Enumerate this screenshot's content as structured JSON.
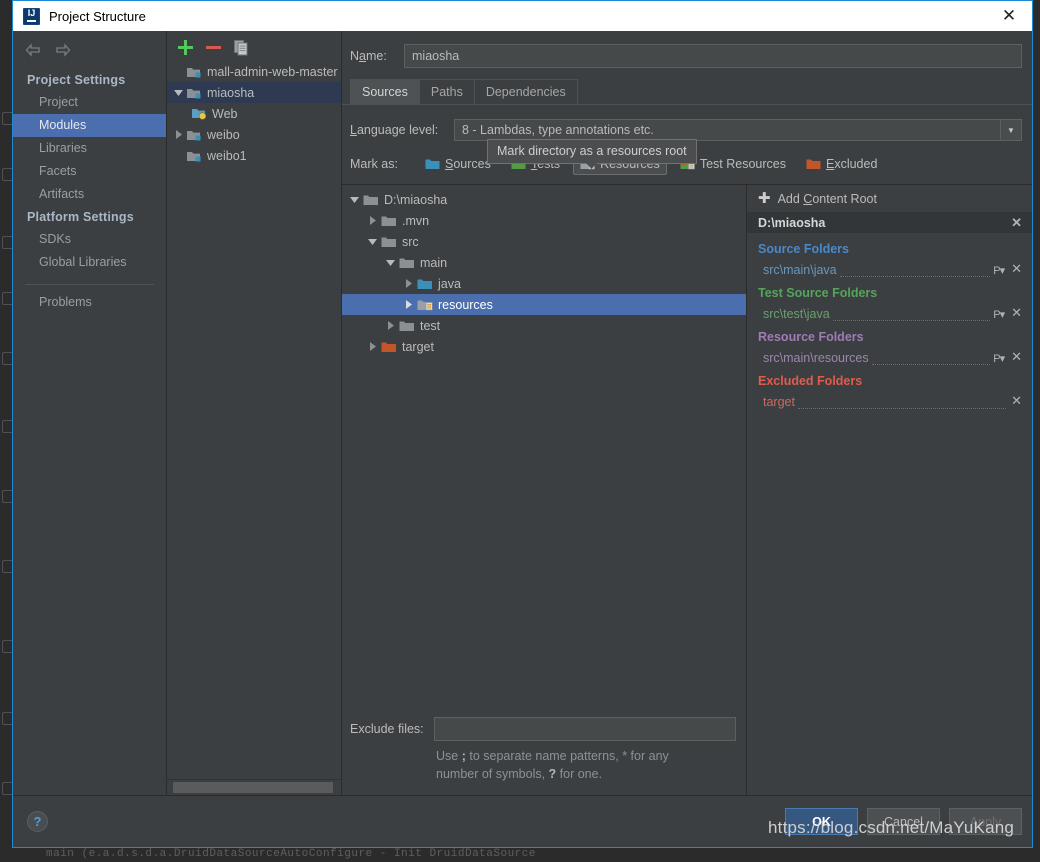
{
  "window": {
    "title": "Project Structure",
    "icon": "intellij-idea-icon",
    "close_label": "✕"
  },
  "left_nav": {
    "back_icon": "arrow-left-icon",
    "forward_icon": "arrow-right-icon",
    "groups": [
      {
        "label": "Project Settings",
        "items": [
          {
            "label": "Project",
            "selected": false
          },
          {
            "label": "Modules",
            "selected": true
          },
          {
            "label": "Libraries",
            "selected": false
          },
          {
            "label": "Facets",
            "selected": false
          },
          {
            "label": "Artifacts",
            "selected": false
          }
        ]
      },
      {
        "label": "Platform Settings",
        "items": [
          {
            "label": "SDKs",
            "selected": false
          },
          {
            "label": "Global Libraries",
            "selected": false
          }
        ]
      }
    ],
    "problems_label": "Problems"
  },
  "modules_panel": {
    "toolbar": {
      "add_icon": "plus-icon",
      "remove_icon": "minus-icon",
      "copy_icon": "copy-icon"
    },
    "items": [
      {
        "label": "mall-admin-web-master",
        "indent": 1,
        "twisty": "none",
        "icon": "module-icon",
        "selected": false
      },
      {
        "label": "miaosha",
        "indent": 1,
        "twisty": "expanded",
        "icon": "module-icon",
        "selected": true
      },
      {
        "label": "Web",
        "indent": 2,
        "twisty": "none",
        "icon": "web-facet-icon",
        "selected": false
      },
      {
        "label": "weibo",
        "indent": 1,
        "twisty": "collapsed",
        "icon": "module-icon",
        "selected": false
      },
      {
        "label": "weibo1",
        "indent": 1,
        "twisty": "none",
        "icon": "module-icon",
        "selected": false
      }
    ]
  },
  "module_editor": {
    "name_label": "Name:",
    "name_value": "miaosha",
    "tabs": [
      {
        "label": "Sources",
        "active": true
      },
      {
        "label": "Paths",
        "active": false
      },
      {
        "label": "Dependencies",
        "active": false
      }
    ],
    "language_level": {
      "label": "Language level:",
      "value": "8 - Lambdas, type annotations etc.",
      "arrow_icon": "chevron-down-icon"
    },
    "mark_as": {
      "label": "Mark as:",
      "buttons": [
        {
          "label": "Sources",
          "icon": "folder-sources-icon",
          "color": "#3b90ba",
          "pressed": false
        },
        {
          "label": "Tests",
          "icon": "folder-tests-icon",
          "color": "#559a47",
          "pressed": false
        },
        {
          "label": "Resources",
          "icon": "folder-resources-icon",
          "color": "#9aa0a6",
          "pressed": true
        },
        {
          "label": "Test Resources",
          "icon": "folder-test-resources-icon",
          "color": "#559a47",
          "pressed": false
        },
        {
          "label": "Excluded",
          "icon": "folder-excluded-icon",
          "color": "#c2562a",
          "pressed": false
        }
      ]
    },
    "tooltip": "Mark directory as a resources root"
  },
  "file_tree": [
    {
      "label": "D:\\miaosha",
      "indent": 0,
      "twisty": "expanded",
      "icon": "folder-grey-icon",
      "selected": false
    },
    {
      "label": ".mvn",
      "indent": 1,
      "twisty": "collapsed",
      "icon": "folder-grey-icon",
      "selected": false
    },
    {
      "label": "src",
      "indent": 1,
      "twisty": "expanded",
      "icon": "folder-grey-icon",
      "selected": false
    },
    {
      "label": "main",
      "indent": 2,
      "twisty": "expanded",
      "icon": "folder-grey-icon",
      "selected": false
    },
    {
      "label": "java",
      "indent": 3,
      "twisty": "collapsed",
      "icon": "folder-blue-icon",
      "selected": false
    },
    {
      "label": "resources",
      "indent": 3,
      "twisty": "collapsed",
      "icon": "folder-resources-icon",
      "selected": true
    },
    {
      "label": "test",
      "indent": 2,
      "twisty": "collapsed",
      "icon": "folder-grey-icon",
      "selected": false
    },
    {
      "label": "target",
      "indent": 1,
      "twisty": "collapsed",
      "icon": "folder-orange-icon",
      "selected": false
    }
  ],
  "exclude": {
    "label": "Exclude files:",
    "value": "",
    "hint_part1": "Use ",
    "hint_semicolon": ";",
    "hint_part2": " to separate name patterns, * for any number of symbols, ",
    "hint_question": "?",
    "hint_part3": " for one.",
    "hint_full": "Use ; to separate name patterns, * for any number of symbols, ? for one."
  },
  "content_roots": {
    "add_label": "Add Content Root",
    "add_icon": "plus-icon",
    "root_path": "D:\\miaosha",
    "remove_icon": "close-icon",
    "groups": [
      {
        "title": "Source Folders",
        "color": "#4a88c7",
        "path_color": "#6897bb",
        "entries": [
          {
            "path": "src\\main\\java",
            "has_package_prefix": true
          }
        ]
      },
      {
        "title": "Test Source Folders",
        "color": "#56a35b",
        "path_color": "#6a9e70",
        "entries": [
          {
            "path": "src\\test\\java",
            "has_package_prefix": true
          }
        ]
      },
      {
        "title": "Resource Folders",
        "color": "#9f7bb5",
        "path_color": "#9c86ae",
        "entries": [
          {
            "path": "src\\main\\resources",
            "has_package_prefix": true
          }
        ]
      },
      {
        "title": "Excluded Folders",
        "color": "#e05c4b",
        "path_color": "#cb6a5c",
        "entries": [
          {
            "path": "target",
            "has_package_prefix": false
          }
        ]
      }
    ],
    "package_prefix_icon": "package-prefix-icon"
  },
  "bottom_bar": {
    "help_icon": "help-icon",
    "help_label": "?",
    "buttons": [
      {
        "label": "OK",
        "style": "primary"
      },
      {
        "label": "Cancel",
        "style": "normal"
      },
      {
        "label": "Apply",
        "style": "disabled"
      }
    ]
  },
  "watermark": "https://blog.csdn.net/MaYuKang",
  "background": {
    "bottom_code": "main (e.a.d.s.d.a.DruidDataSourceAutoConfigure   -  Init DruidDataSource"
  },
  "colors": {
    "dialog_bg": "#3c3f41",
    "accent_selection": "#4b6eaf",
    "border_blue": "#1e8ad6",
    "title_bg": "#ffffff",
    "text_primary": "#bbbbbb"
  }
}
